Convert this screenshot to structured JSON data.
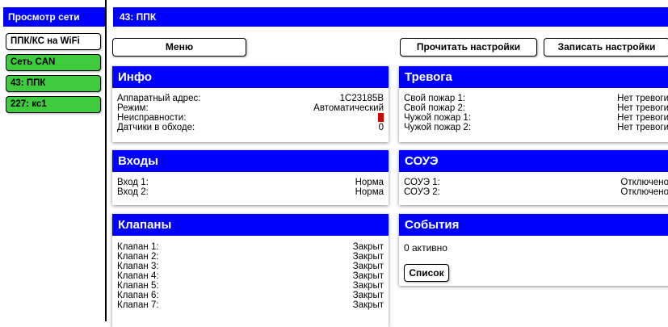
{
  "sidebar": {
    "title": "Просмотр сети",
    "items": [
      {
        "label": "ППК/КС на WiFi",
        "style": "white"
      },
      {
        "label": "Сеть CAN",
        "style": "green"
      },
      {
        "label": "43: ППК",
        "style": "green"
      },
      {
        "label": "227: кс1",
        "style": "green"
      }
    ]
  },
  "header": {
    "title": "43: ППК"
  },
  "toolbar": {
    "menu_label": "Меню",
    "read_label": "Прочитать настройки",
    "write_label": "Записать настройки"
  },
  "colors": {
    "accent": "#0000ff",
    "active": "#3ecc3e",
    "fault": "#cc0000"
  },
  "info": {
    "title": "Инфо",
    "rows": [
      {
        "label": "Аппаратный адрес:",
        "value": "1C23185B"
      },
      {
        "label": "Режим:",
        "value": "Автоматический"
      },
      {
        "label": "Неисправности:",
        "value": ""
      },
      {
        "label": "Датчики в обходе:",
        "value": "0"
      }
    ]
  },
  "alarm": {
    "title": "Тревога",
    "rows": [
      {
        "label": "Свой пожар 1:",
        "value": "Нет тревоги"
      },
      {
        "label": "Свой пожар 2:",
        "value": "Нет тревоги"
      },
      {
        "label": "Чужой пожар 1:",
        "value": "Нет тревоги"
      },
      {
        "label": "Чужой пожар 2:",
        "value": "Нет тревоги"
      }
    ]
  },
  "inputs": {
    "title": "Входы",
    "rows": [
      {
        "label": "Вход 1:",
        "value": "Норма"
      },
      {
        "label": "Вход 2:",
        "value": "Норма"
      }
    ]
  },
  "soue": {
    "title": "СОУЭ",
    "rows": [
      {
        "label": "СОУЭ 1:",
        "value": "Отключено"
      },
      {
        "label": "СОУЭ 2:",
        "value": "Отключено"
      }
    ]
  },
  "valves": {
    "title": "Клапаны",
    "rows": [
      {
        "label": "Клапан 1:",
        "value": "Закрыт"
      },
      {
        "label": "Клапан 2:",
        "value": "Закрыт"
      },
      {
        "label": "Клапан 3:",
        "value": "Закрыт"
      },
      {
        "label": "Клапан 4:",
        "value": "Закрыт"
      },
      {
        "label": "Клапан 5:",
        "value": "Закрыт"
      },
      {
        "label": "Клапан 6:",
        "value": "Закрыт"
      },
      {
        "label": "Клапан 7:",
        "value": "Закрыт"
      }
    ]
  },
  "events": {
    "title": "События",
    "status": "0 активно",
    "list_label": "Список"
  }
}
